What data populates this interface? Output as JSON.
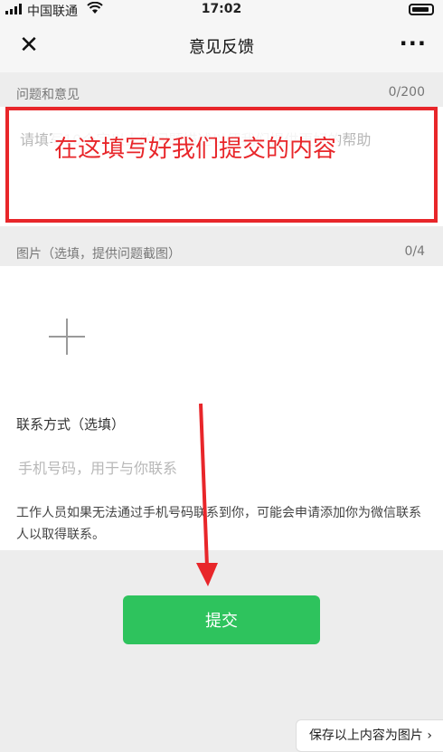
{
  "status_bar": {
    "carrier": "中国联通",
    "time": "17:02",
    "icons": [
      "signal-icon",
      "wifi-icon",
      "battery-icon"
    ]
  },
  "nav": {
    "close_icon": "close-icon",
    "title": "意见反馈",
    "more_icon": "more-icon"
  },
  "feedback": {
    "label": "问题和意见",
    "counter": "0/200",
    "placeholder": "请填写10个字以上的问题描述以便我们提供更好的帮助",
    "annotation": "在这填写好我们提交的内容"
  },
  "images": {
    "label": "图片（选填，提供问题截图）",
    "counter": "0/4",
    "add_icon": "plus-icon"
  },
  "contact": {
    "label": "联系方式（选填）",
    "phone_placeholder": "手机号码，用于与你联系",
    "notice": "工作人员如果无法通过手机号码联系到你，可能会申请添加你为微信联系人以取得联系。"
  },
  "submit": {
    "label": "提交"
  },
  "save_button": {
    "label": "保存以上内容为图片 ›"
  },
  "colors": {
    "accent_green": "#2ec35d",
    "annotation_red": "#e8262a",
    "background": "#ededed"
  }
}
